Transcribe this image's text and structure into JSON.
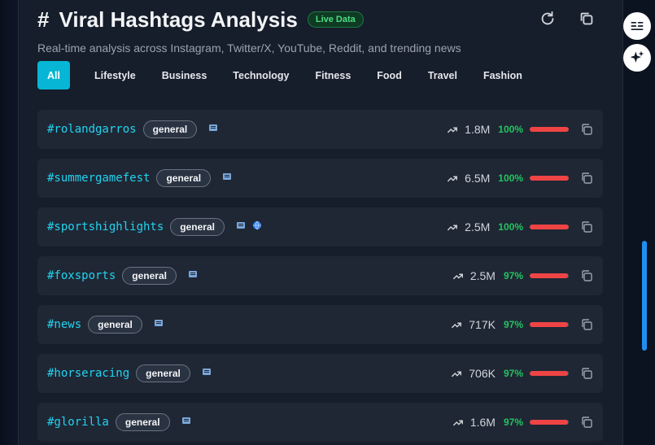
{
  "header": {
    "hash_symbol": "#",
    "title": "Viral Hashtags Analysis",
    "live_badge": "Live Data",
    "subtitle": "Real-time analysis across Instagram, Twitter/X, YouTube, Reddit, and trending news"
  },
  "tabs": [
    {
      "label": "All",
      "active": true
    },
    {
      "label": "Lifestyle"
    },
    {
      "label": "Business"
    },
    {
      "label": "Technology"
    },
    {
      "label": "Fitness"
    },
    {
      "label": "Food"
    },
    {
      "label": "Travel"
    },
    {
      "label": "Fashion"
    }
  ],
  "hashtags": [
    {
      "tag": "#rolandgarros",
      "category": "general",
      "sources": [
        "news-icon"
      ],
      "count": "1.8M",
      "percent": "100%",
      "fill": 1.0
    },
    {
      "tag": "#summergamefest",
      "category": "general",
      "sources": [
        "news-icon"
      ],
      "count": "6.5M",
      "percent": "100%",
      "fill": 1.0
    },
    {
      "tag": "#sportshighlights",
      "category": "general",
      "sources": [
        "news-icon",
        "globe-icon"
      ],
      "count": "2.5M",
      "percent": "100%",
      "fill": 1.0
    },
    {
      "tag": "#foxsports",
      "category": "general",
      "sources": [
        "news-icon"
      ],
      "count": "2.5M",
      "percent": "97%",
      "fill": 0.97
    },
    {
      "tag": "#news",
      "category": "general",
      "sources": [
        "news-icon"
      ],
      "count": "717K",
      "percent": "97%",
      "fill": 0.97
    },
    {
      "tag": "#horseracing",
      "category": "general",
      "sources": [
        "news-icon"
      ],
      "count": "706K",
      "percent": "97%",
      "fill": 0.97
    },
    {
      "tag": "#glorilla",
      "category": "general",
      "sources": [
        "news-icon"
      ],
      "count": "1.6M",
      "percent": "97%",
      "fill": 0.97
    }
  ],
  "colors": {
    "accent": "#06b6d4",
    "hashtag": "#22d3ee",
    "percent": "#22c55e",
    "bar": "#ef4444",
    "live": "#4ade80"
  }
}
